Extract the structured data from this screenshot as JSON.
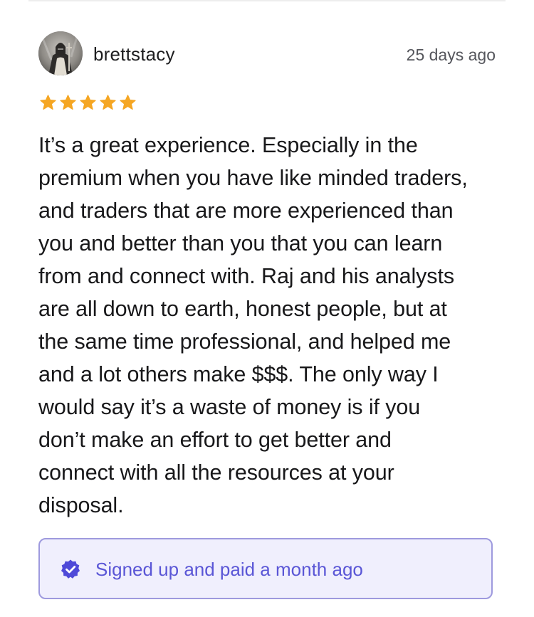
{
  "review": {
    "username": "brettstacy",
    "timestamp": "25 days ago",
    "rating": 5,
    "rating_max": 5,
    "star_color": "#f5a623",
    "text_lines": [
      "It’s a great experience. Especially in the",
      "premium when you have like minded traders,",
      "and traders that are more experienced than",
      "you and better than you that you can learn",
      "from and connect with. Raj and his analysts",
      "are all down to earth, honest people, but at",
      "the same time professional, and helped me",
      "and a lot others make $$$. The only way I",
      "would say it’s a waste of money is if you",
      "don’t make an effort to get better and",
      "connect with all the resources at your",
      "disposal."
    ],
    "verified_label": "Signed up and paid a month ago",
    "verified_color": "#5a56d6",
    "avatar_icon": "user-avatar-knight"
  }
}
